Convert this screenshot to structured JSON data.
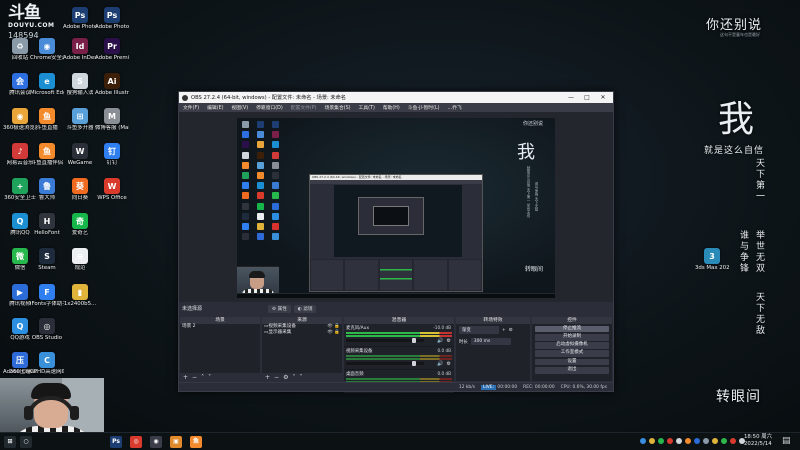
{
  "watermark": {
    "brand_big": "斗鱼",
    "brand_small": "DOUYU.COM",
    "room_number": "148594"
  },
  "desktop_icons": [
    {
      "label": "回收站",
      "color": "#8a9aa8",
      "glyph": "♻"
    },
    {
      "label": "Adobe Photosh...",
      "color": "#1d3e73",
      "glyph": "Ps"
    },
    {
      "label": "Adobe Photosh...",
      "color": "#1d3e73",
      "glyph": "Ps"
    },
    {
      "label": "腾讯会议",
      "color": "#2d6ee0",
      "glyph": "会"
    },
    {
      "label": "Chrome安全浏览器",
      "color": "#4a8bd8",
      "glyph": "◉"
    },
    {
      "label": "Adobe InDesi...",
      "color": "#7a1f47",
      "glyph": "Id"
    },
    {
      "label": "Adobe Premie...",
      "color": "#2a0f4a",
      "glyph": "Pr"
    },
    {
      "label": "360极速浏览器",
      "color": "#e9a43a",
      "glyph": "◉"
    },
    {
      "label": "Microsoft Edge",
      "color": "#1b8fd2",
      "glyph": "e"
    },
    {
      "label": "搜狗输入法",
      "color": "#cfd6dc",
      "glyph": "S"
    },
    {
      "label": "Adobe Illustrat...",
      "color": "#3b1f08",
      "glyph": "Ai"
    },
    {
      "label": "网易云音乐",
      "color": "#d23a3a",
      "glyph": "♪"
    },
    {
      "label": "斗鱼直播",
      "color": "#f38a2b",
      "glyph": "鱼"
    },
    {
      "label": "斗鱼多开器",
      "color": "#5aa0d8",
      "glyph": "⊞"
    },
    {
      "label": "微博客服 (Maiyang...",
      "color": "#8a8f96",
      "glyph": "M"
    },
    {
      "label": "360安全卫士",
      "color": "#1fa35a",
      "glyph": "+"
    },
    {
      "label": "斗鱼直播伴侣",
      "color": "#f38a2b",
      "glyph": "鱼"
    },
    {
      "label": "WeGame",
      "color": "#2b2f38",
      "glyph": "W"
    },
    {
      "label": "钉钉",
      "color": "#2f7ff0",
      "glyph": "钉"
    },
    {
      "label": "腾讯QQ",
      "color": "#1b8fd2",
      "glyph": "Q"
    },
    {
      "label": "鲁大师",
      "color": "#3a7bd5",
      "glyph": "鲁"
    },
    {
      "label": "向日葵",
      "color": "#f06a1f",
      "glyph": "葵"
    },
    {
      "label": "WPS Office",
      "color": "#d93a2b",
      "glyph": "W"
    },
    {
      "label": "微信",
      "color": "#27b84d",
      "glyph": "微"
    },
    {
      "label": "HelloFont",
      "color": "#30343c",
      "glyph": "H"
    },
    {
      "label": "爱奇艺",
      "color": "#17b64a",
      "glyph": "奇"
    },
    {
      "label": "腾讯视频",
      "color": "#2b6cd8",
      "glyph": "▶"
    },
    {
      "label": "Steam",
      "color": "#1d2b3c",
      "glyph": "S"
    },
    {
      "label": "规范",
      "color": "#eceff1",
      "glyph": "≡"
    },
    {
      "label": "QQ游戏",
      "color": "#2b8ee0",
      "glyph": "Q"
    },
    {
      "label": "iFonts字体助手",
      "color": "#2f7ff0",
      "glyph": "F"
    },
    {
      "label": "1x2400b5...",
      "color": "#e0b43a",
      "glyph": "▮"
    },
    {
      "label": "Adobe Creati...",
      "color": "#d8322e",
      "glyph": "Cc"
    },
    {
      "label": "OBS Studio",
      "color": "#2b2e38",
      "glyph": "◎"
    },
    {
      "label": "360压缩",
      "color": "#2e6bd8",
      "glyph": "压"
    },
    {
      "label": "CPHD高速网络加速",
      "color": "#3a90d8",
      "glyph": "C"
    }
  ],
  "wallpaper": {
    "title": "你还别说",
    "subtitle": "这句不是童年也是最好",
    "big_char": "我",
    "line": "就是这么自信",
    "vertical_1": "天下第一",
    "vertical_2": "谁与争锋",
    "vertical_3": "举世无双",
    "vertical_4": "天下无敌",
    "bottom": "转眼间",
    "desktop_file": {
      "label": "3ds Max 2020 - S...",
      "color": "#2a8ab8",
      "glyph": "3"
    }
  },
  "obs": {
    "title": "OBS 27.2.4 (64-bit, windows) - 配置文件: 未命名 - 场景: 未命名",
    "menu": [
      {
        "label": "文件(F)"
      },
      {
        "label": "编辑(E)"
      },
      {
        "label": "视图(V)"
      },
      {
        "label": "停靠窗口(D)"
      },
      {
        "label": "配置文件(P)",
        "dim": true
      },
      {
        "label": "场景集合(S)"
      },
      {
        "label": "工具(T)"
      },
      {
        "label": "帮助(H)"
      },
      {
        "label": "斗鱼-jl-暂时(L)"
      },
      {
        "label": "...乔飞"
      }
    ],
    "canvas": {
      "title": "你还别说",
      "big_char": "我",
      "vertical_1": "就是这么自信 天下第一 举世无双",
      "vertical_2": "谁与争锋 天下无敌",
      "bottom": "转眼间"
    },
    "no_source": "未选择源",
    "properties_btn": "属性",
    "filters_btn": "滤镜",
    "docks": {
      "scenes": {
        "header": "场景",
        "items": [
          "场景 2"
        ]
      },
      "sources": {
        "header": "来源",
        "items": [
          "视频采集设备",
          "显示器采集"
        ]
      },
      "mixer": {
        "header": "混音器",
        "channels": [
          {
            "name": "麦克风/Aux",
            "db": "-10.0 dB",
            "level": 0.7,
            "fader": 0.84
          },
          {
            "name": "视频采集设备",
            "db": "0.0 dB",
            "level": 0.0,
            "fader": 0.84
          },
          {
            "name": "桌面音频",
            "db": "0.0 dB",
            "level": 0.0,
            "fader": 0.84
          }
        ]
      },
      "transitions": {
        "header": "转场特效",
        "type": "渐变",
        "duration_label": "时长",
        "duration": "300 ms"
      },
      "controls": {
        "header": "控件",
        "buttons": [
          "停止推流",
          "开始录制",
          "启动虚拟摄像机",
          "工作室模式",
          "设置",
          "退出"
        ],
        "active_index": 0
      }
    },
    "status": {
      "live_label": "LIVE:",
      "live_time": "00:00:00",
      "rec_label": "REC:",
      "rec_time": "00:00:00",
      "cpu": "CPU: 0.6%, 30.00 fps",
      "kbps": "12 kb/s"
    }
  },
  "taskbar": {
    "icons": [
      {
        "glyph": "⊞",
        "color": "#222a30"
      },
      {
        "glyph": "○",
        "color": "#222a30"
      },
      {
        "glyph": "Ps",
        "color": "#1d3e73"
      },
      {
        "glyph": "◎",
        "color": "#d83a2e"
      },
      {
        "glyph": "◉",
        "color": "#3a3d47"
      },
      {
        "glyph": "▣",
        "color": "#e08a2b"
      },
      {
        "glyph": "鱼",
        "color": "#f38a2b"
      }
    ],
    "time": "18:50 周六",
    "date": "2022/5/14"
  }
}
